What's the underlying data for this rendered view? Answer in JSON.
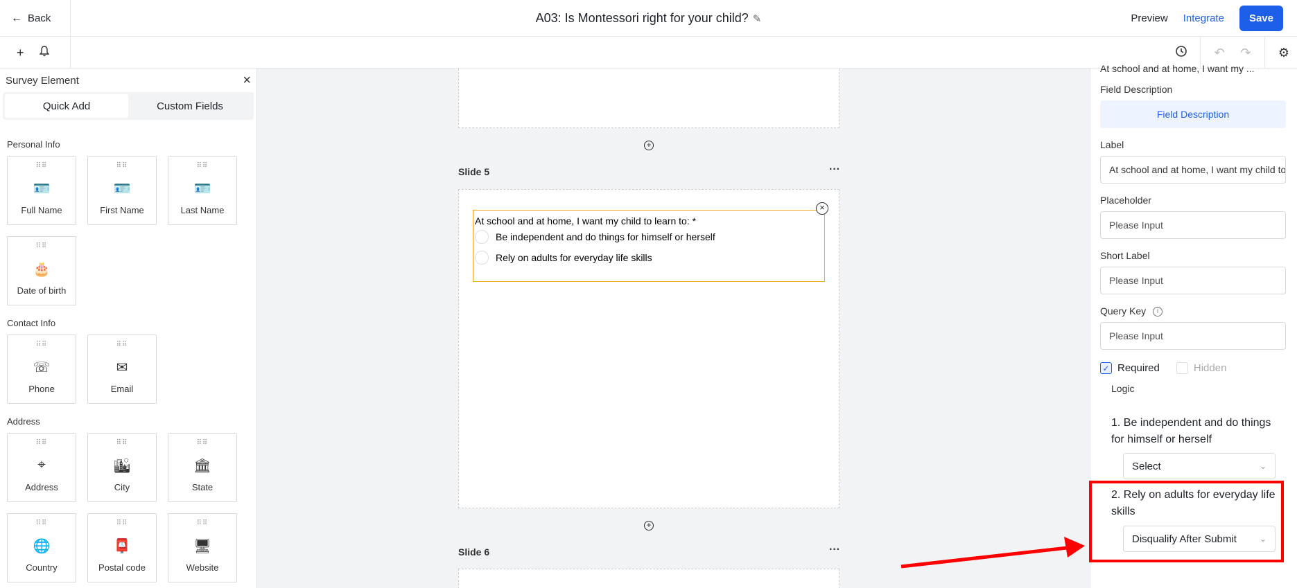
{
  "header": {
    "back_label": "Back",
    "title": "A03: Is Montessori right for your child?",
    "preview_label": "Preview",
    "integrate_label": "Integrate",
    "save_label": "Save"
  },
  "left_panel": {
    "title": "Survey Element",
    "tabs": [
      "Quick Add",
      "Custom Fields"
    ],
    "sections": {
      "personal": "Personal Info",
      "contact": "Contact Info",
      "address": "Address"
    },
    "personal_items": [
      "Full Name",
      "First Name",
      "Last Name",
      "Date of birth"
    ],
    "contact_items": [
      "Phone",
      "Email"
    ],
    "address_items": [
      "Address",
      "City",
      "State",
      "Country",
      "Postal code",
      "Website"
    ]
  },
  "canvas": {
    "slide5_title": "Slide 5",
    "slide6_title": "Slide 6",
    "question": {
      "text": "At school and at home, I want my child to learn to: *",
      "options": [
        "Be independent and do things for himself or herself",
        "Rely on adults for everyday life skills"
      ]
    }
  },
  "right_panel": {
    "cut_title": "At school and at home, I want my ...",
    "field_description_label": "Field Description",
    "field_description_button": "Field Description",
    "label_label": "Label",
    "label_value": "At school and at home, I want my child to learn to:",
    "placeholder_label": "Placeholder",
    "placeholder_placeholder": "Please Input",
    "short_label_label": "Short Label",
    "short_label_placeholder": "Please Input",
    "query_key_label": "Query Key",
    "query_key_placeholder": "Please Input",
    "required_label": "Required",
    "hidden_label": "Hidden",
    "logic_label": "Logic",
    "logic_items": [
      {
        "num": "1.",
        "text": "Be independent and do things for himself or herself",
        "select": "Select"
      },
      {
        "num": "2.",
        "text": "Rely on adults for everyday life skills",
        "select": "Disqualify After Submit"
      }
    ]
  },
  "colors": {
    "accent": "#1d5fe8",
    "selection_border": "#f5a623",
    "annotation": "#ff0000"
  }
}
